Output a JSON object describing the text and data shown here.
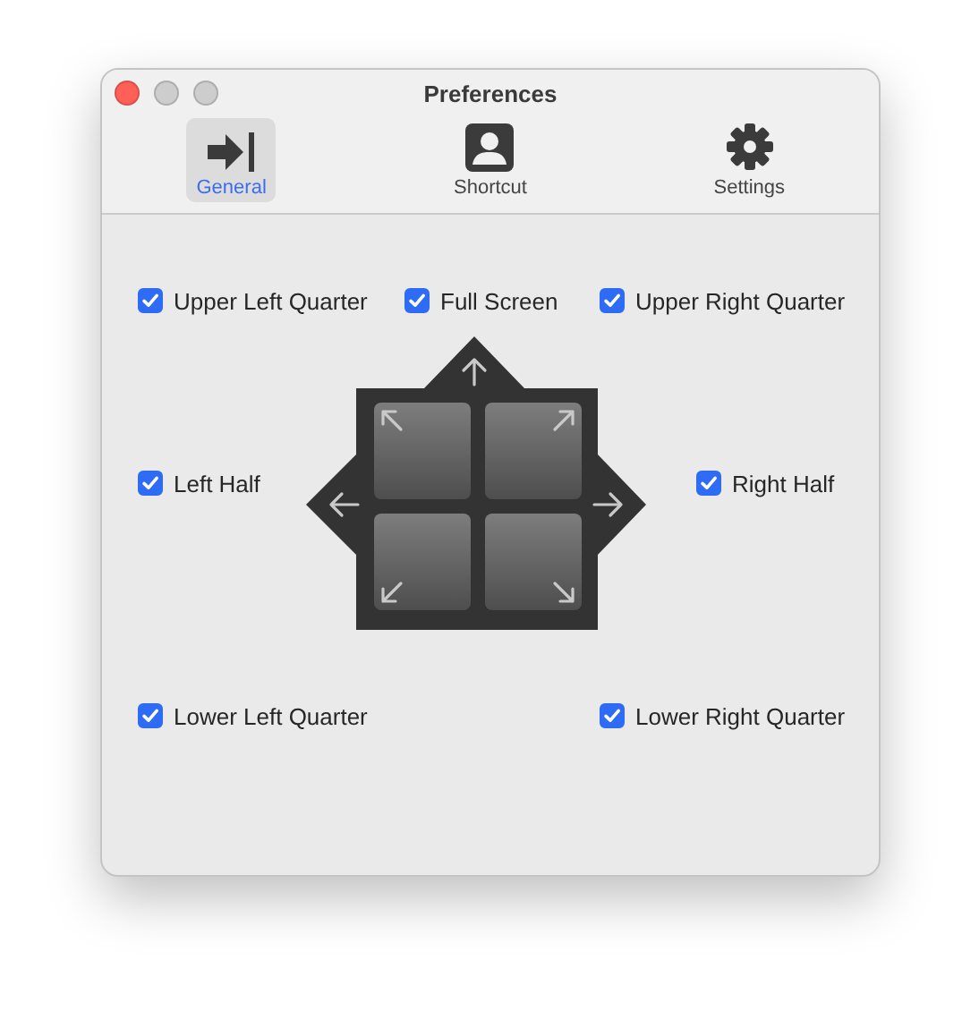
{
  "window": {
    "title": "Preferences"
  },
  "tabs": [
    {
      "label": "General",
      "kind": "general",
      "selected": true
    },
    {
      "label": "Shortcut",
      "kind": "shortcut",
      "selected": false
    },
    {
      "label": "Settings",
      "kind": "settings",
      "selected": false
    }
  ],
  "top_row": [
    {
      "label": "Upper Left Quarter",
      "checked": true
    },
    {
      "label": "Full Screen",
      "checked": true
    },
    {
      "label": "Upper Right Quarter",
      "checked": true
    }
  ],
  "left_option": {
    "label": "Left Half",
    "checked": true
  },
  "right_option": {
    "label": "Right Half",
    "checked": true
  },
  "bottom_row": [
    {
      "label": "Lower Left Quarter",
      "checked": true
    },
    {
      "label": "Lower Right Quarter",
      "checked": true
    }
  ]
}
